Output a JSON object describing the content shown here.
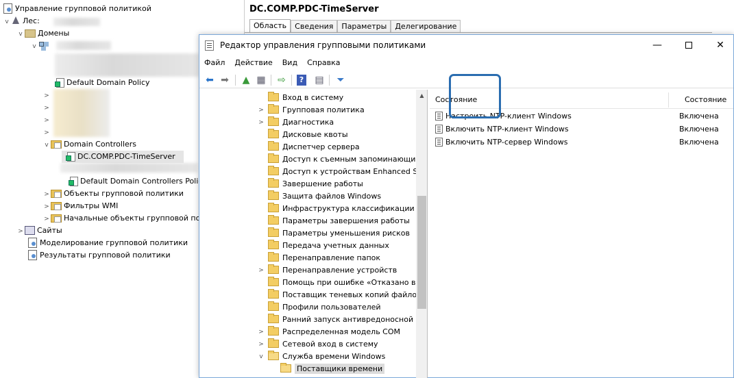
{
  "gpmc": {
    "tree": {
      "root_label": "Управление групповой политикой",
      "forest_label": "Лес:",
      "domains_label": "Домены",
      "default_domain_policy": "Default Domain Policy",
      "domain_controllers": "Domain Controllers",
      "selected_gpo": "DC.COMP.PDC-TimeServer",
      "default_dc_policy": "Default Domain Controllers Polic",
      "gpo_objects": "Объекты групповой политики",
      "wmi_filters": "Фильтры WMI",
      "starter_gpos": "Начальные объекты групповой по",
      "sites": "Сайты",
      "modeling": "Моделирование групповой политики",
      "results": "Результаты групповой политики"
    },
    "right": {
      "title": "DC.COMP.PDC-TimeServer",
      "tabs": [
        "Область",
        "Сведения",
        "Параметры",
        "Делегирование"
      ]
    }
  },
  "gpme": {
    "title": "Редактор управления групповыми политиками",
    "window_buttons": {
      "minimize": "—",
      "close": "✕"
    },
    "menu": [
      "Файл",
      "Действие",
      "Вид",
      "Справка"
    ],
    "toolbar_icons": [
      "back-arrow-icon",
      "forward-arrow-icon",
      "up-folder-icon",
      "show-hide-tree-icon",
      "export-list-icon",
      "help-icon",
      "properties-pane-icon",
      "filter-icon"
    ],
    "tree_items": [
      {
        "label": "Вход в систему",
        "expander": ""
      },
      {
        "label": "Групповая политика",
        "expander": ">"
      },
      {
        "label": "Диагностика",
        "expander": ">"
      },
      {
        "label": "Дисковые квоты",
        "expander": ""
      },
      {
        "label": "Диспетчер сервера",
        "expander": ""
      },
      {
        "label": "Доступ к съемным запоминающи",
        "expander": ""
      },
      {
        "label": "Доступ к устройствам Enhanced Sto",
        "expander": ""
      },
      {
        "label": "Завершение работы",
        "expander": ""
      },
      {
        "label": "Защита файлов Windows",
        "expander": ""
      },
      {
        "label": "Инфраструктура классификации ф",
        "expander": ""
      },
      {
        "label": "Параметры завершения работы",
        "expander": ""
      },
      {
        "label": "Параметры уменьшения рисков",
        "expander": ""
      },
      {
        "label": "Передача учетных данных",
        "expander": ""
      },
      {
        "label": "Перенаправление папок",
        "expander": ""
      },
      {
        "label": "Перенаправление устройств",
        "expander": ">"
      },
      {
        "label": "Помощь при ошибке «Отказано в",
        "expander": ""
      },
      {
        "label": "Поставщик теневых копий файлов",
        "expander": ""
      },
      {
        "label": "Профили пользователей",
        "expander": ""
      },
      {
        "label": "Ранний запуск антивредоносной п",
        "expander": ""
      },
      {
        "label": "Распределенная модель COM",
        "expander": ">"
      },
      {
        "label": "Сетевой вход в систему",
        "expander": ">"
      },
      {
        "label": "Служба времени Windows",
        "expander": "v"
      }
    ],
    "selected_child": "Поставщики времени",
    "list": {
      "col_setting": "Состояние",
      "col_state": "Состояние",
      "rows": [
        {
          "name": "Настроить NTP-клиент Windows",
          "state": "Включена"
        },
        {
          "name": "Включить NTP-клиент Windows",
          "state": "Включена"
        },
        {
          "name": "Включить NTP-сервер Windows",
          "state": "Включена"
        }
      ]
    }
  }
}
